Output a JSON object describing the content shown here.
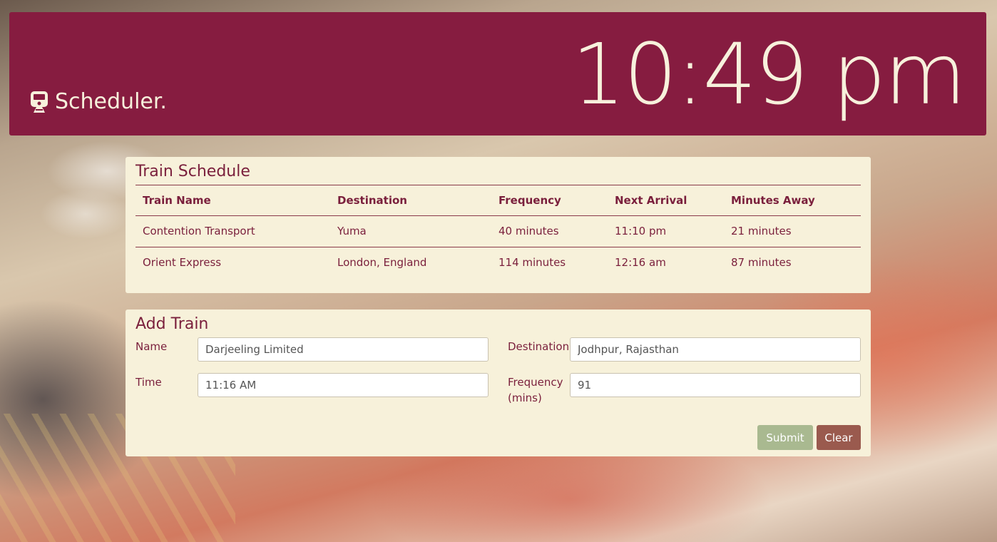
{
  "header": {
    "brand": "Scheduler.",
    "clock": "10:49 pm"
  },
  "schedule": {
    "title": "Train Schedule",
    "columns": [
      "Train Name",
      "Destination",
      "Frequency",
      "Next Arrival",
      "Minutes Away"
    ],
    "rows": [
      [
        "Contention Transport",
        "Yuma",
        "40 minutes",
        "11:10 pm",
        "21 minutes"
      ],
      [
        "Orient Express",
        "London, England",
        "114 minutes",
        "12:16 am",
        "87 minutes"
      ]
    ]
  },
  "add_train": {
    "title": "Add Train",
    "name_label": "Name",
    "name_value": "Darjeeling Limited",
    "destination_label": "Destination",
    "destination_value": "Jodhpur, Rajasthan",
    "time_label": "Time",
    "time_value": "11:16 AM",
    "frequency_label_line1": "Frequency",
    "frequency_label_line2": "(mins)",
    "frequency_value": "91",
    "submit_label": "Submit",
    "clear_label": "Clear"
  },
  "colors": {
    "header_bg": "#861c40",
    "panel_bg": "#f7f1da",
    "text": "#7a1f3c",
    "submit": "#a9b990",
    "clear": "#9a5a4e"
  }
}
